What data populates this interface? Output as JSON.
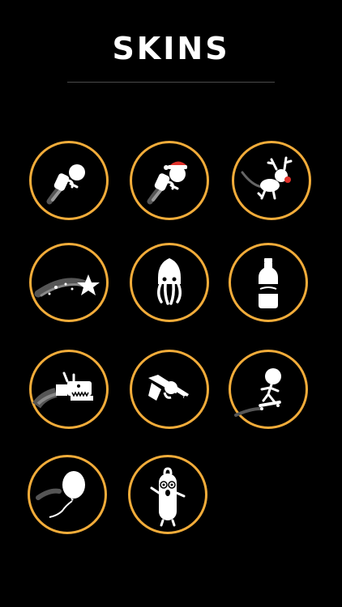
{
  "header": {
    "title": "SKINS"
  },
  "colors": {
    "background": "#000000",
    "ring": "#f2ac3a",
    "icon": "#ffffff",
    "accent_red": "#e0322b",
    "divider": "#4a4a4a"
  },
  "skins": [
    {
      "icon": "jetpack-stickman-icon"
    },
    {
      "icon": "jetpack-santa-hat-icon"
    },
    {
      "icon": "reindeer-icon"
    },
    {
      "icon": "shooting-star-icon"
    },
    {
      "icon": "squid-icon"
    },
    {
      "icon": "bottle-icon"
    },
    {
      "icon": "dragon-icon"
    },
    {
      "icon": "revolver-icon"
    },
    {
      "icon": "skateboard-stickman-icon"
    },
    {
      "icon": "balloon-icon"
    },
    {
      "icon": "sausage-icon"
    }
  ]
}
